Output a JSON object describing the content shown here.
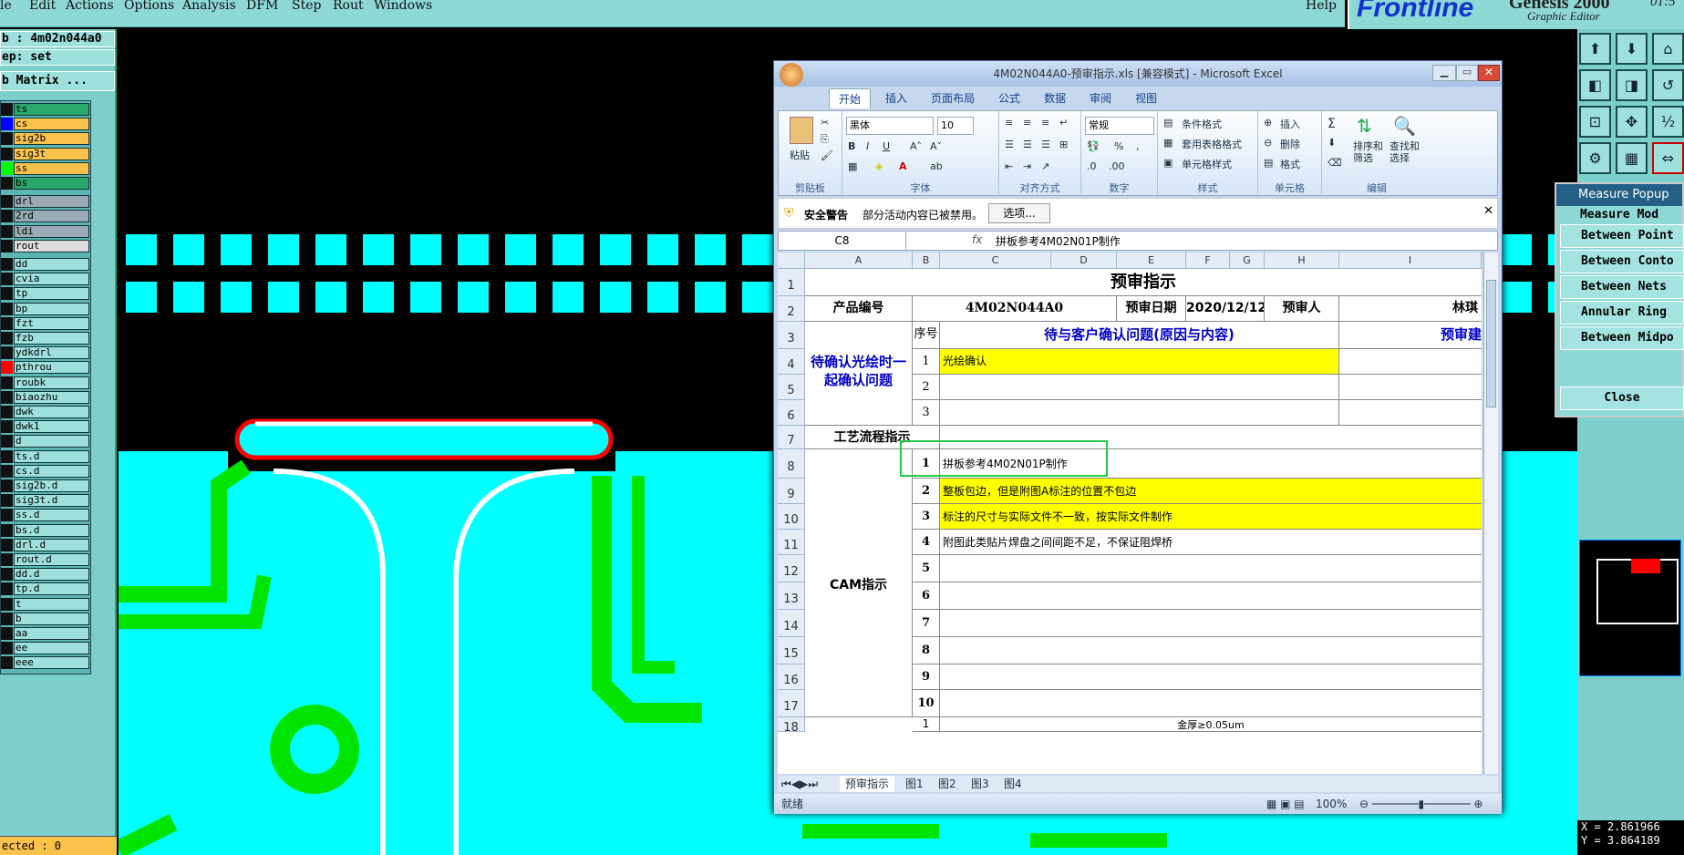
{
  "menubar": {
    "items": [
      "le",
      "Edit",
      "Actions",
      "Options",
      "Analysis",
      "DFM",
      "Step",
      "Rout",
      "Windows"
    ],
    "help": "Help",
    "logo": "Frontline",
    "product": "Genesis 2000",
    "product_sub": "Graphic Editor",
    "clock": "01:5"
  },
  "left": {
    "job": "b : 4m02n044a0",
    "step": "ep: set",
    "matrix": "b Matrix ...",
    "layers": [
      {
        "name": "ts",
        "sw": "#111"
      },
      {
        "name": "cs",
        "sw": "#0000ff"
      },
      {
        "name": "sig2b",
        "sw": "#111"
      },
      {
        "name": "sig3t",
        "sw": "#111"
      },
      {
        "name": "ss",
        "sw": "#00ff00"
      },
      {
        "name": "bs",
        "sw": "#111"
      },
      {
        "name": "drl",
        "sw": "#111"
      },
      {
        "name": "2rd",
        "sw": "#111"
      },
      {
        "name": "ldi",
        "sw": "#111"
      },
      {
        "name": "rout",
        "sw": "#111"
      },
      {
        "name": "dd",
        "sw": "#111"
      },
      {
        "name": "cvia",
        "sw": "#111"
      },
      {
        "name": "tp",
        "sw": "#111"
      },
      {
        "name": "bp",
        "sw": "#111"
      },
      {
        "name": "fzt",
        "sw": "#111"
      },
      {
        "name": "fzb",
        "sw": "#111"
      },
      {
        "name": "ydkdrl",
        "sw": "#111"
      },
      {
        "name": "pthrou",
        "sw": "#ff0000"
      },
      {
        "name": "roubk",
        "sw": "#111"
      },
      {
        "name": "biaozhu",
        "sw": "#111"
      },
      {
        "name": "dwk",
        "sw": "#111"
      },
      {
        "name": "dwk1",
        "sw": "#111"
      },
      {
        "name": "d",
        "sw": "#111"
      },
      {
        "name": "ts.d",
        "sw": "#111"
      },
      {
        "name": "cs.d",
        "sw": "#111"
      },
      {
        "name": "sig2b.d",
        "sw": "#111"
      },
      {
        "name": "sig3t.d",
        "sw": "#111"
      },
      {
        "name": "ss.d",
        "sw": "#111"
      },
      {
        "name": "bs.d",
        "sw": "#111"
      },
      {
        "name": "drl.d",
        "sw": "#111"
      },
      {
        "name": "rout.d",
        "sw": "#111"
      },
      {
        "name": "dd.d",
        "sw": "#111"
      },
      {
        "name": "tp.d",
        "sw": "#111"
      },
      {
        "name": "t",
        "sw": "#111"
      },
      {
        "name": "b",
        "sw": "#111"
      },
      {
        "name": "aa",
        "sw": "#111"
      },
      {
        "name": "ee",
        "sw": "#111"
      },
      {
        "name": "eee",
        "sw": "#111"
      }
    ],
    "selected": "ected : 0"
  },
  "measure": {
    "title": "Measure Popup",
    "header": "Measure Mod",
    "options": [
      "Between Point",
      "Between Conto",
      "Between Nets",
      "Annular Ring",
      "Between Midpo"
    ],
    "close": "Close"
  },
  "coords": {
    "x": "X = 2.861966",
    "y": "Y = 3.864189"
  },
  "excel": {
    "title": "4M02N044A0-预审指示.xls  [兼容模式] - Microsoft Excel",
    "tabs": [
      "开始",
      "插入",
      "页面布局",
      "公式",
      "数据",
      "审阅",
      "视图"
    ],
    "ribbon": {
      "paste": "粘贴",
      "clipboard": "剪贴板",
      "font": "字体",
      "font_name": "黑体",
      "font_size": "10",
      "align": "对齐方式",
      "number": "数字",
      "number_fmt": "常规",
      "styles": "样式",
      "cond_fmt": "条件格式",
      "table_fmt": "套用表格格式",
      "cell_style": "单元格样式",
      "cells": "单元格",
      "insert": "插入",
      "delete": "删除",
      "format": "格式",
      "edit": "编辑",
      "sort": "排序和\n筛选",
      "find": "查找和\n选择"
    },
    "security": {
      "title": "安全警告",
      "msg": "部分活动内容已被禁用。",
      "btn": "选项..."
    },
    "namebox": "C8",
    "formula": "拼板参考4M02N01P制作",
    "cols": [
      "A",
      "B",
      "C",
      "D",
      "E",
      "F",
      "G",
      "H",
      "I"
    ],
    "rows": [
      "1",
      "2",
      "3",
      "4",
      "5",
      "6",
      "7",
      "8",
      "9",
      "10",
      "11",
      "12",
      "13",
      "14",
      "15",
      "16",
      "17",
      "18"
    ],
    "sheet": {
      "title": "预审指示",
      "product_label": "产品编号",
      "product_no": "4M02N044A0",
      "date_label": "预审日期",
      "date": "2020/12/12",
      "reviewer_label": "预审人",
      "reviewer": "林琪",
      "pending_label": "待确认光绘时一起确认问题",
      "seq_label": "序号",
      "pending_header": "待与客户确认问题(原因与内容)",
      "pending_header2": "预审建",
      "pending_1": "光绘确认",
      "process_label": "工艺流程指示",
      "cam_label": "CAM指示",
      "cam_items": [
        "拼板参考4M02N01P制作",
        "整板包边，但是附图A标注的位置不包边",
        "标注的尺寸与实际文件不一致，按实际文件制作",
        "附图此类贴片焊盘之间间距不足，不保证阻焊桥",
        "",
        "",
        "",
        "",
        "",
        ""
      ],
      "nums": [
        "1",
        "2",
        "3",
        "1",
        "2",
        "3",
        "4",
        "5",
        "6",
        "7",
        "8",
        "9",
        "10",
        "1"
      ],
      "row18_text": "金厚≥0.05um"
    },
    "sheet_tabs": [
      "预审指示",
      "图1",
      "图2",
      "图3",
      "图4"
    ],
    "status": "就绪",
    "zoom": "100%"
  }
}
